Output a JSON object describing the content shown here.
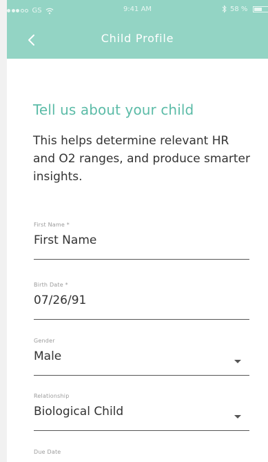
{
  "status_bar": {
    "carrier": "GS",
    "time": "9:41 AM",
    "battery_percent": "58 %",
    "battery_level": 0.58
  },
  "header": {
    "title": "Child Profile",
    "back_icon": "chevron-left-icon"
  },
  "colors": {
    "accent": "#93d4c4",
    "heading": "#5bbba7",
    "text": "#333333",
    "label": "#9a9a9a"
  },
  "form": {
    "heading": "Tell us about your child",
    "intro": "This helps determine relevant HR and O2 ranges, and produce smarter insights.",
    "fields": {
      "first_name": {
        "label": "First Name *",
        "placeholder": "First Name"
      },
      "birth_date": {
        "label": "Birth Date *",
        "value": "07/26/91"
      },
      "gender": {
        "label": "Gender",
        "value": "Male"
      },
      "relationship": {
        "label": "Relationship",
        "value": "Biological Child"
      },
      "due_date": {
        "label": "Due Date"
      }
    }
  }
}
